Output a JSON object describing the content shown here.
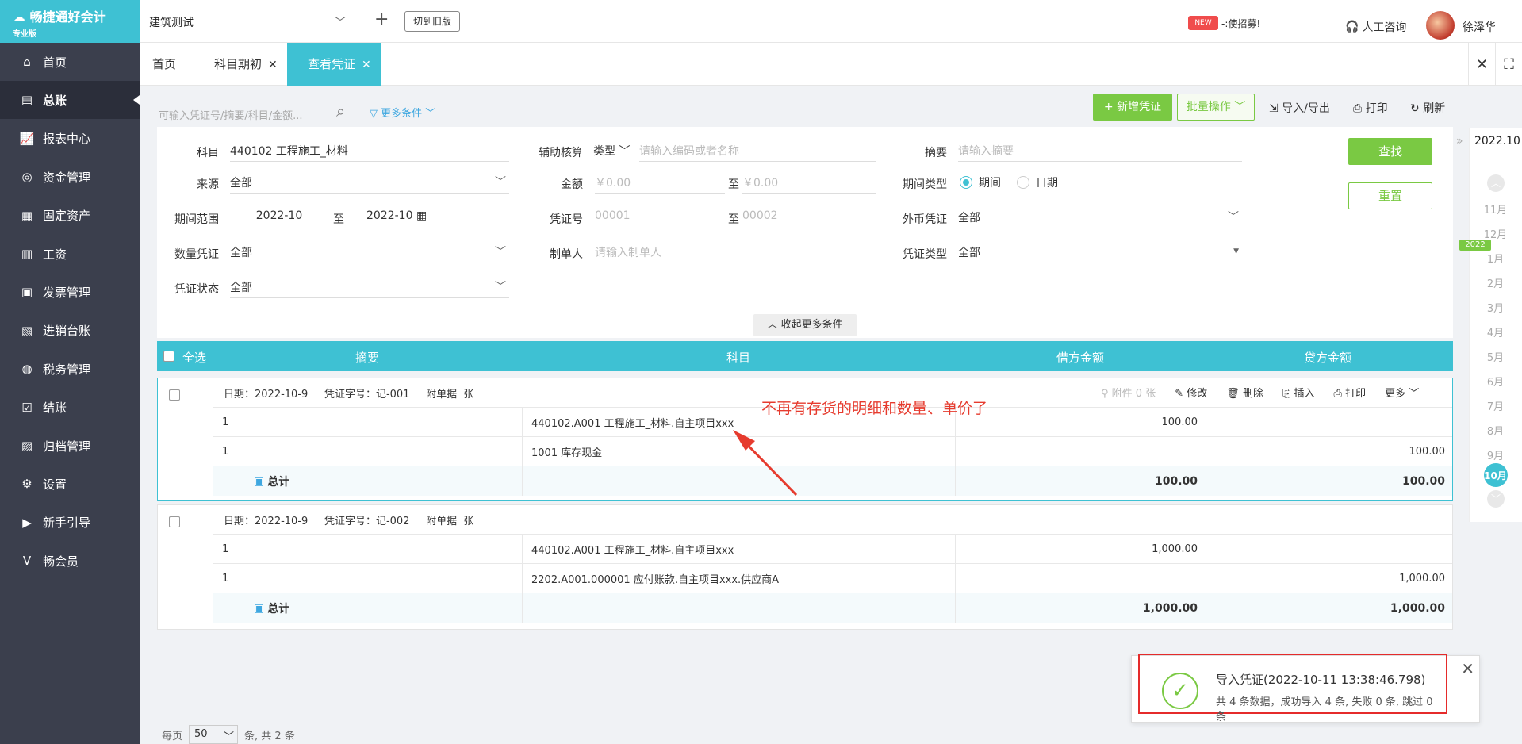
{
  "brand": {
    "name": "畅捷通好会计",
    "edition": "专业版"
  },
  "sidebar": {
    "items": [
      {
        "label": "首页",
        "icon": "home-icon"
      },
      {
        "label": "总账",
        "icon": "ledger-icon"
      },
      {
        "label": "报表中心",
        "icon": "chart-icon"
      },
      {
        "label": "资金管理",
        "icon": "money-bag-icon"
      },
      {
        "label": "固定资产",
        "icon": "building-icon"
      },
      {
        "label": "工资",
        "icon": "salary-icon"
      },
      {
        "label": "发票管理",
        "icon": "invoice-icon"
      },
      {
        "label": "进销台账",
        "icon": "inventory-icon"
      },
      {
        "label": "税务管理",
        "icon": "tax-icon"
      },
      {
        "label": "结账",
        "icon": "checkout-icon"
      },
      {
        "label": "归档管理",
        "icon": "archive-icon"
      },
      {
        "label": "设置",
        "icon": "gear-icon"
      },
      {
        "label": "新手引导",
        "icon": "guide-icon"
      },
      {
        "label": "畅会员",
        "icon": "vip-icon"
      }
    ]
  },
  "topbar": {
    "company": "建筑测试",
    "switch_old": "切到旧版",
    "recruit_text": "-:使招募!",
    "new_badge": "NEW",
    "consult": "人工咨询",
    "user": "徐泽华"
  },
  "tabs": [
    {
      "label": "首页"
    },
    {
      "label": "科目期初"
    },
    {
      "label": "查看凭证"
    }
  ],
  "search": {
    "placeholder": "可输入凭证号/摘要/科目/金额...",
    "more": "更多条件"
  },
  "toolbar": {
    "new_voucher": "+ 新增凭证",
    "batch": "批量操作",
    "import_export": "导入/导出",
    "print": "打印",
    "refresh": "刷新"
  },
  "filters": {
    "subject_label": "科目",
    "subject_value": "440102  工程施工_材料",
    "aux_label": "辅助核算",
    "aux_type": "类型",
    "aux_placeholder": "请输入编码或者名称",
    "summary_label": "摘要",
    "summary_placeholder": "请输入摘要",
    "source_label": "来源",
    "source_value": "全部",
    "amount_label": "金额",
    "amount_from_ph": "￥0.00",
    "to": "至",
    "amount_to_ph": "￥0.00",
    "period_type_label": "期间类型",
    "period_opt": "期间",
    "date_opt": "日期",
    "period_range_label": "期间范围",
    "period_from": "2022-10",
    "period_to": "2022-10",
    "voucher_no_label": "凭证号",
    "voucher_from_ph": "00001",
    "voucher_to_ph": "00002",
    "fx_label": "外币凭证",
    "fx_value": "全部",
    "qty_label": "数量凭证",
    "qty_value": "全部",
    "maker_label": "制单人",
    "maker_placeholder": "请输入制单人",
    "vtype_label": "凭证类型",
    "vtype_value": "全部",
    "status_label": "凭证状态",
    "status_value": "全部",
    "find": "查找",
    "reset": "重置",
    "collapse": "收起更多条件"
  },
  "table": {
    "headers": {
      "select_all": "全选",
      "summary": "摘要",
      "subject": "科目",
      "debit": "借方金额",
      "credit": "贷方金额"
    },
    "actions": {
      "attach": "附件 0 张",
      "edit": "修改",
      "delete": "删除",
      "insert": "插入",
      "print": "打印",
      "more": "更多"
    },
    "vouchers": [
      {
        "head": "日期：2022-10-9     凭证字号：记-001     附单据  张",
        "rows": [
          {
            "summary": "1",
            "subject": "440102.A001  工程施工_材料.自主项目xxx",
            "debit": "100.00",
            "credit": ""
          },
          {
            "summary": "1",
            "subject": "1001 库存现金",
            "debit": "",
            "credit": "100.00"
          }
        ],
        "total_label": "总计",
        "total_debit": "100.00",
        "total_credit": "100.00"
      },
      {
        "head": "日期：2022-10-9     凭证字号：记-002     附单据  张",
        "rows": [
          {
            "summary": "1",
            "subject": "440102.A001  工程施工_材料.自主项目xxx",
            "debit": "1,000.00",
            "credit": ""
          },
          {
            "summary": "1",
            "subject": "2202.A001.000001  应付账款.自主项目xxx.供应商A",
            "debit": "",
            "credit": "1,000.00"
          }
        ],
        "total_label": "总计",
        "total_debit": "1,000.00",
        "total_credit": "1,000.00"
      }
    ]
  },
  "annotation": "不再有存货的明细和数量、单价了",
  "timeline": {
    "current": "2022.10",
    "year_badge": "2022",
    "months": [
      "11月",
      "12月",
      "1月",
      "2月",
      "3月",
      "4月",
      "5月",
      "6月",
      "7月",
      "8月",
      "9月",
      "10月"
    ]
  },
  "pager": {
    "per_page": "每页",
    "size": "50",
    "unit": "条, 共 2 条"
  },
  "toast": {
    "title": "导入凭证(2022-10-11 13:38:46.798)",
    "detail": "共 4 条数据，成功导入 4 条, 失败 0 条, 跳过 0 条"
  },
  "colors": {
    "primary": "#3ec1d3",
    "green": "#7ac943",
    "sidebar": "#3b3f4d",
    "annotation": "#e63b2e"
  }
}
